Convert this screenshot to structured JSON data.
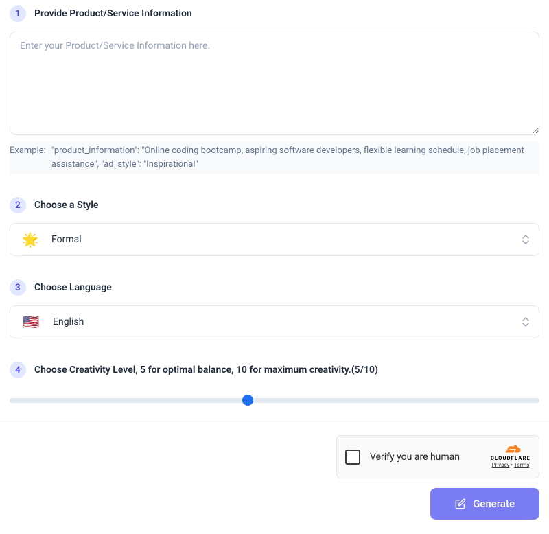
{
  "step1": {
    "num": "1",
    "label": "Provide Product/Service Information",
    "placeholder": "Enter your Product/Service Information here.",
    "example_label": "Example:",
    "example_text": "\"product_information\": \"Online coding bootcamp, aspiring software developers, flexible learning schedule, job placement assistance\", \"ad_style\": \"Inspirational\""
  },
  "step2": {
    "num": "2",
    "label": "Choose a Style",
    "icon": "🌟",
    "value": "Formal"
  },
  "step3": {
    "num": "3",
    "label": "Choose Language",
    "flag": "🇺🇸",
    "value": "English"
  },
  "step4": {
    "num": "4",
    "label": "Choose Creativity Level, 5 for optimal balance, 10 for maximum creativity.(5/10)"
  },
  "captcha": {
    "label": "Verify you are human",
    "brand": "CLOUDFLARE",
    "privacy": "Privacy",
    "terms": "Terms",
    "sep": " • "
  },
  "generate_label": "Generate"
}
